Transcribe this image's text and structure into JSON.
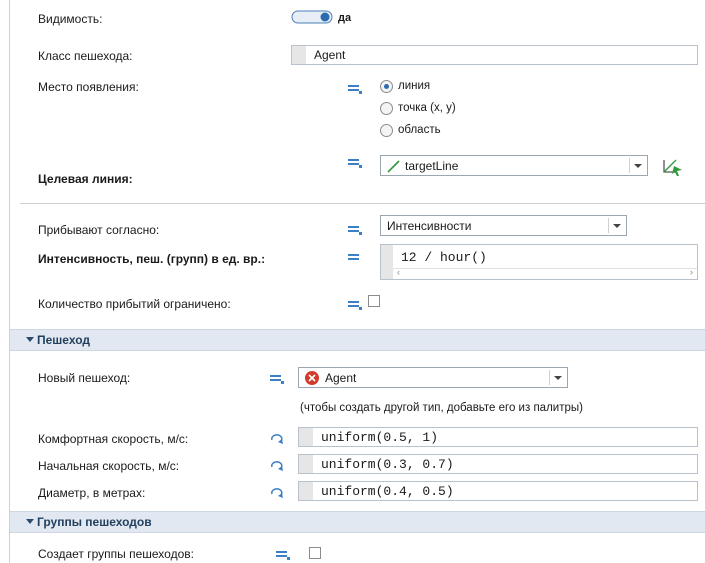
{
  "visibility": {
    "label": "Видимость:",
    "value": "да"
  },
  "ped_class": {
    "label": "Класс пешехода:",
    "value": "Agent"
  },
  "spawn_place": {
    "label": "Место появления:",
    "options": [
      {
        "label": "линия",
        "selected": true
      },
      {
        "label": "точка (x, y)",
        "selected": false
      },
      {
        "label": "область",
        "selected": false
      }
    ]
  },
  "target_line": {
    "label": "Целевая линия:",
    "value": "targetLine"
  },
  "arrive_by": {
    "label": "Прибывают согласно:",
    "value": "Интенсивности"
  },
  "intensity": {
    "label": "Интенсивность, пеш. (групп) в ед. вр.:",
    "value": "12 / hour()"
  },
  "limited": {
    "label": "Количество прибытий ограничено:"
  },
  "sections": {
    "pedestrian": "Пешеход",
    "groups": "Группы пешеходов"
  },
  "new_ped": {
    "label": "Новый пешеход:",
    "value": "Agent",
    "hint": "(чтобы создать другой тип, добавьте его из палитры)"
  },
  "comfort_speed": {
    "label": "Комфортная скорость, м/с:",
    "value": "uniform(0.5, 1)"
  },
  "initial_speed": {
    "label": "Начальная скорость, м/с:",
    "value": "uniform(0.3, 0.7)"
  },
  "diameter": {
    "label": "Диаметр, в метрах:",
    "value": "uniform(0.4, 0.5)"
  },
  "creates_groups": {
    "label": "Создает группы пешеходов:"
  },
  "colors": {
    "accent": "#3c7fc4",
    "section_bg": "#e1e8f1",
    "error": "#d23a2c",
    "line_green": "#2e9a3a"
  }
}
